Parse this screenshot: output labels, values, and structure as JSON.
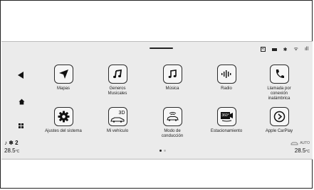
{
  "status": {
    "box_glyph": "R",
    "bt_glyph": "✱",
    "wifi_glyph": "ᯤ",
    "signal_glyph": "ıll"
  },
  "side": {
    "fan_level": "♪ ❄ 2",
    "temp_left": "28.5",
    "temp_right": "28.5",
    "temp_unit": "°C",
    "auto_label": "AUTO"
  },
  "apps": [
    {
      "label": "Mapas",
      "icon": "map-arrow-icon"
    },
    {
      "label": "Generos\nMusicales",
      "icon": "music-genres-icon"
    },
    {
      "label": "Música",
      "icon": "music-note-icon"
    },
    {
      "label": "Radio",
      "icon": "radio-icon"
    },
    {
      "label": "Llamada por\nconexión\ninalámbrica",
      "icon": "phone-icon"
    },
    {
      "label": "Ajustes del sistema",
      "icon": "gear-icon"
    },
    {
      "label": "Mi vehículo",
      "icon": "car-3d-icon",
      "badge": "3D"
    },
    {
      "label": "Modo de\nconducción",
      "icon": "drive-mode-icon"
    },
    {
      "label": "Estacionamiento",
      "icon": "parking-camera-icon",
      "badge": "360°"
    },
    {
      "label": "Apple CarPlay",
      "icon": "carplay-icon"
    }
  ],
  "pager": {
    "total": 2,
    "active": 1
  }
}
